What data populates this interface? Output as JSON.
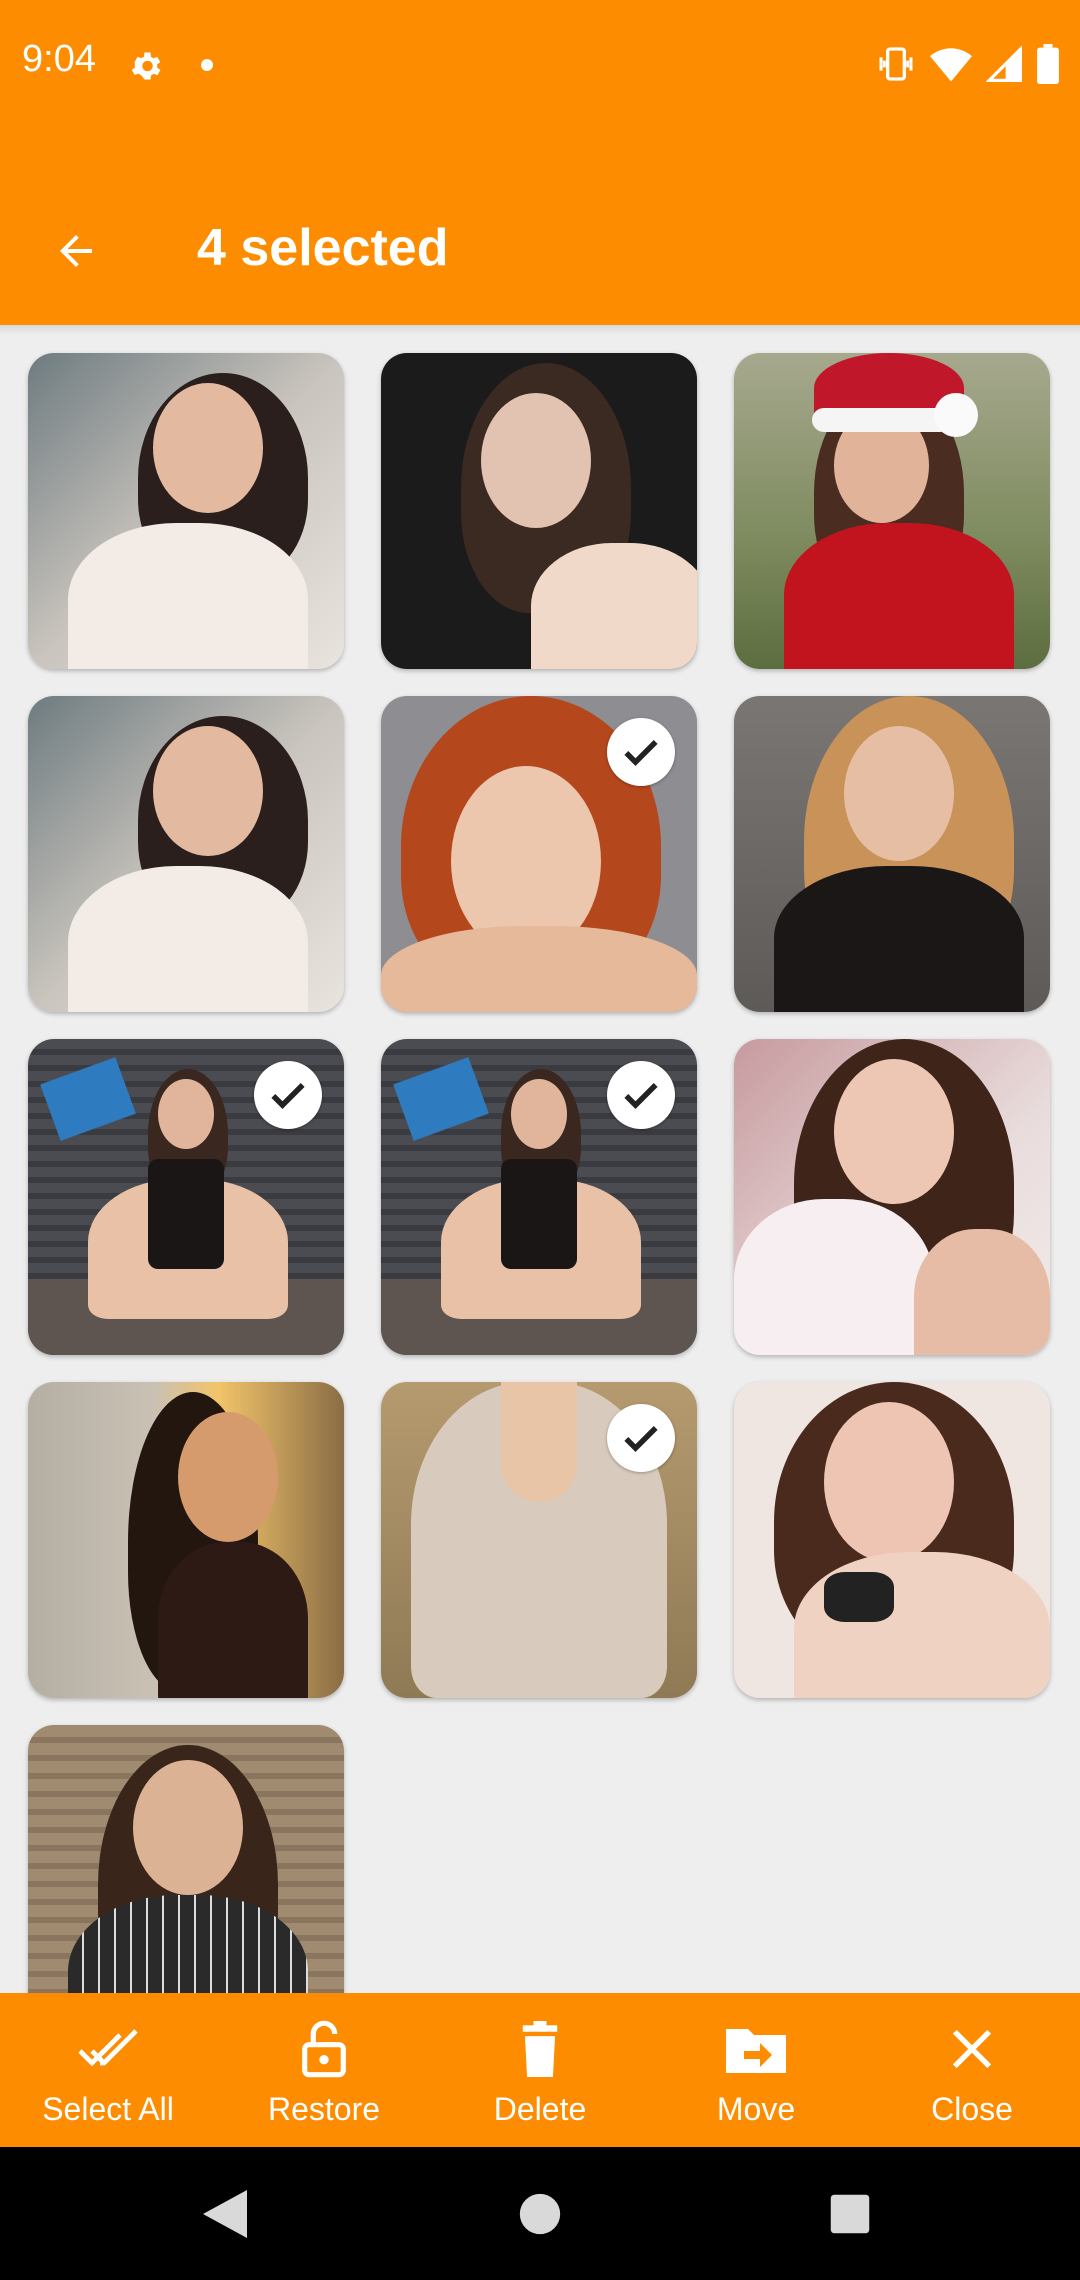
{
  "status_bar": {
    "time": "9:04",
    "icons": [
      "gear-icon",
      "notification-dot-icon",
      "vibrate-icon",
      "wifi-icon",
      "signal-icon",
      "battery-icon"
    ]
  },
  "app_bar": {
    "title": "4 selected",
    "back_icon": "arrow-left-icon"
  },
  "colors": {
    "accent": "#fd8c00",
    "background": "#eeeeee",
    "nav": "#000000"
  },
  "photos": [
    {
      "selected": false
    },
    {
      "selected": false
    },
    {
      "selected": false
    },
    {
      "selected": false
    },
    {
      "selected": true
    },
    {
      "selected": false
    },
    {
      "selected": true
    },
    {
      "selected": true
    },
    {
      "selected": false
    },
    {
      "selected": false
    },
    {
      "selected": true
    },
    {
      "selected": false
    },
    {
      "selected": false
    }
  ],
  "actions": [
    {
      "label": "Select All",
      "icon": "double-check-icon"
    },
    {
      "label": "Restore",
      "icon": "unlock-icon"
    },
    {
      "label": "Delete",
      "icon": "trash-icon"
    },
    {
      "label": "Move",
      "icon": "folder-move-icon"
    },
    {
      "label": "Close",
      "icon": "close-icon"
    }
  ],
  "nav": {
    "icons": [
      "back-triangle-icon",
      "home-circle-icon",
      "recents-square-icon"
    ]
  }
}
